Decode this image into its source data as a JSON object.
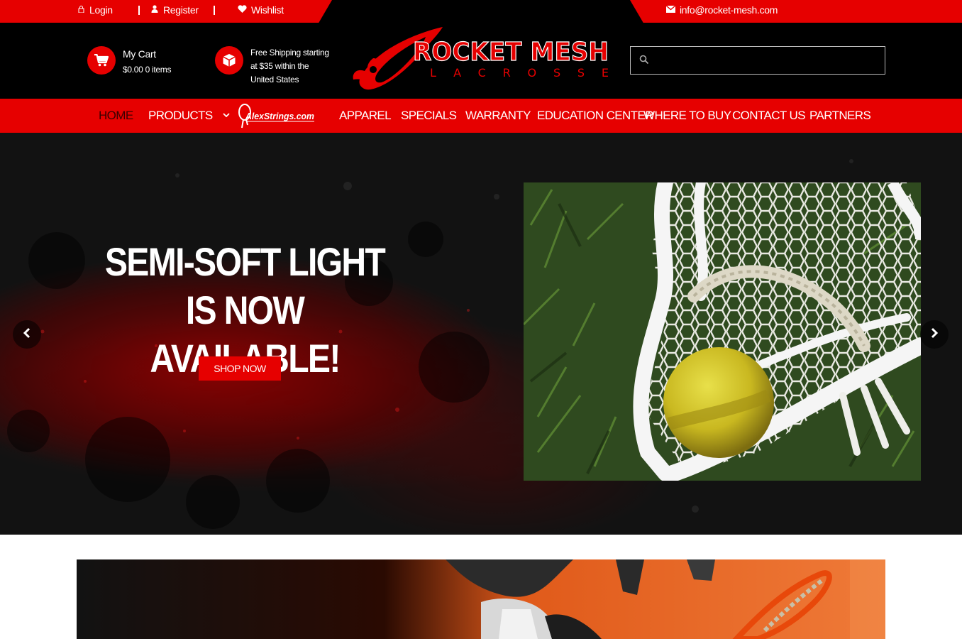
{
  "topbar": {
    "login": "Login",
    "register": "Register",
    "wishlist": "Wishlist",
    "email": "info@rocket-mesh.com"
  },
  "header": {
    "cart_title": "My Cart",
    "cart_summary": "$0.00 0 items",
    "shipping_line1": "Free Shipping starting",
    "shipping_line2": "at $35 within the",
    "shipping_line3": "United States",
    "logo_main": "ROCKET MESH",
    "logo_sub": "L A C R O S S E",
    "search_value": ""
  },
  "nav": {
    "items": [
      {
        "label": "HOME"
      },
      {
        "label": "PRODUCTS"
      },
      {
        "label": "AlexStrings.com"
      },
      {
        "label": "APPAREL"
      },
      {
        "label": "SPECIALS"
      },
      {
        "label": "WARRANTY"
      },
      {
        "label": "EDUCATION CENTER"
      },
      {
        "label": "WHERE TO BUY"
      },
      {
        "label": "CONTACT US"
      },
      {
        "label": "PARTNERS"
      }
    ]
  },
  "hero": {
    "title_line1": "SEMI-SOFT LIGHT",
    "title_line2": "IS NOW AVAILABLE!",
    "button": "SHOP NOW"
  },
  "colors": {
    "accent": "#e60000",
    "dark": "#000000",
    "active_nav": "#3a0000"
  },
  "icons": [
    "lock-icon",
    "user-icon",
    "heart-icon",
    "envelope-icon",
    "cart-icon",
    "box-icon",
    "search-icon",
    "chevron-down-icon",
    "chevron-left-icon",
    "chevron-right-icon"
  ]
}
